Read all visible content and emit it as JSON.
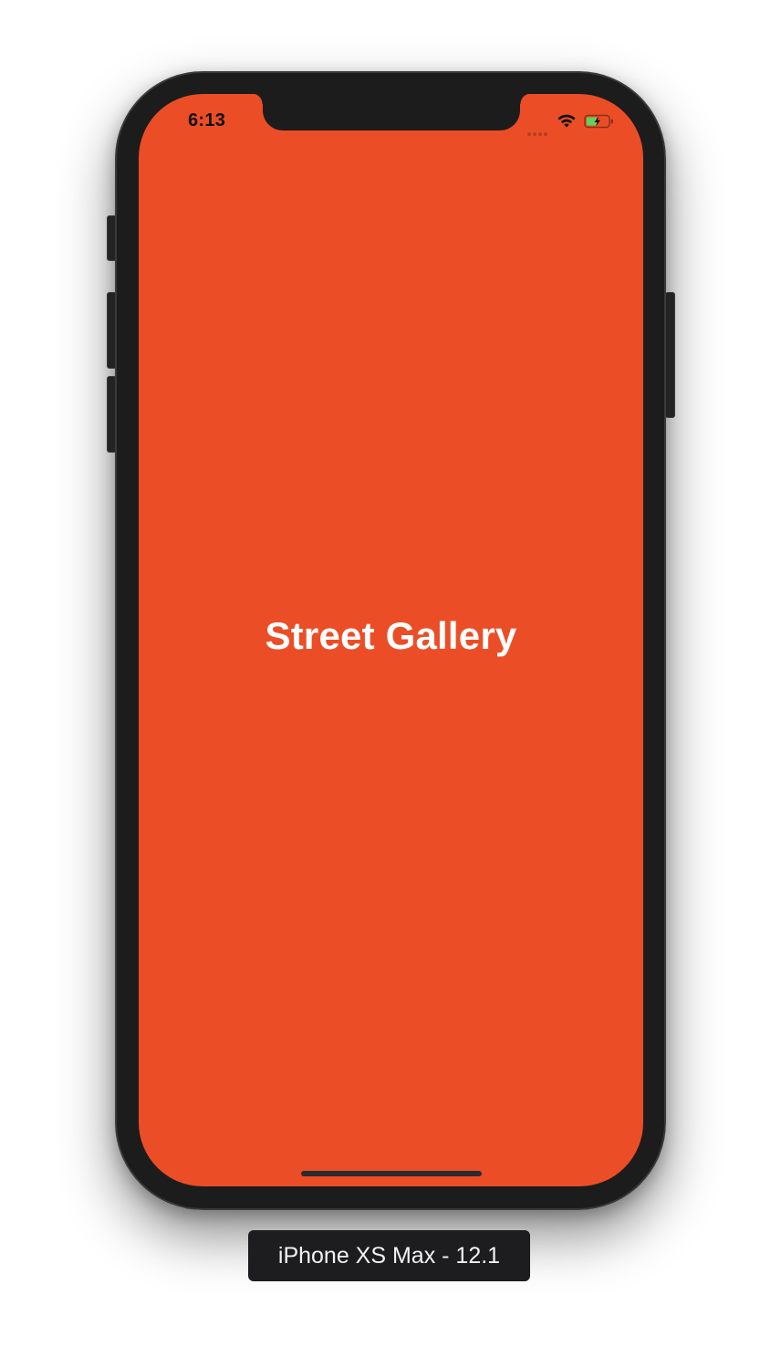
{
  "status_bar": {
    "time": "6:13",
    "icons": [
      "cellular-signal-icon",
      "wifi-icon",
      "battery-charging-icon"
    ]
  },
  "app": {
    "title": "Street Gallery",
    "background_color": "#eb4e27",
    "title_color": "#ffffff"
  },
  "simulator": {
    "device_label": "iPhone XS Max - 12.1",
    "frame_color": "#1c1c1c"
  }
}
